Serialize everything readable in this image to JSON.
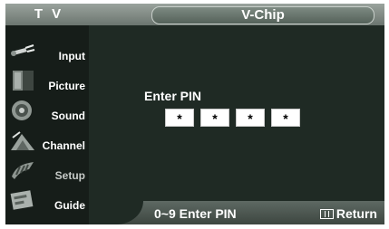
{
  "header": {
    "tv_label": "T V",
    "menu_title": "V-Chip"
  },
  "sidebar": {
    "items": [
      {
        "label": "Input",
        "icon": "input-plug-icon"
      },
      {
        "label": "Picture",
        "icon": "picture-icon"
      },
      {
        "label": "Sound",
        "icon": "speaker-icon"
      },
      {
        "label": "Channel",
        "icon": "satellite-dish-icon"
      },
      {
        "label": "Setup",
        "icon": "setup-icon"
      },
      {
        "label": "Guide",
        "icon": "program-guide-icon"
      }
    ]
  },
  "main": {
    "prompt": "Enter PIN",
    "pin_digits": [
      "*",
      "*",
      "*",
      "*"
    ]
  },
  "footer": {
    "hint": "0~9 Enter PIN",
    "return_label": "Return",
    "return_icon": "menu-return-icon"
  },
  "colors": {
    "background": "#1f2a24",
    "bar": "#6b756f",
    "text": "#ffffff",
    "pin_box": "#ffffff"
  }
}
